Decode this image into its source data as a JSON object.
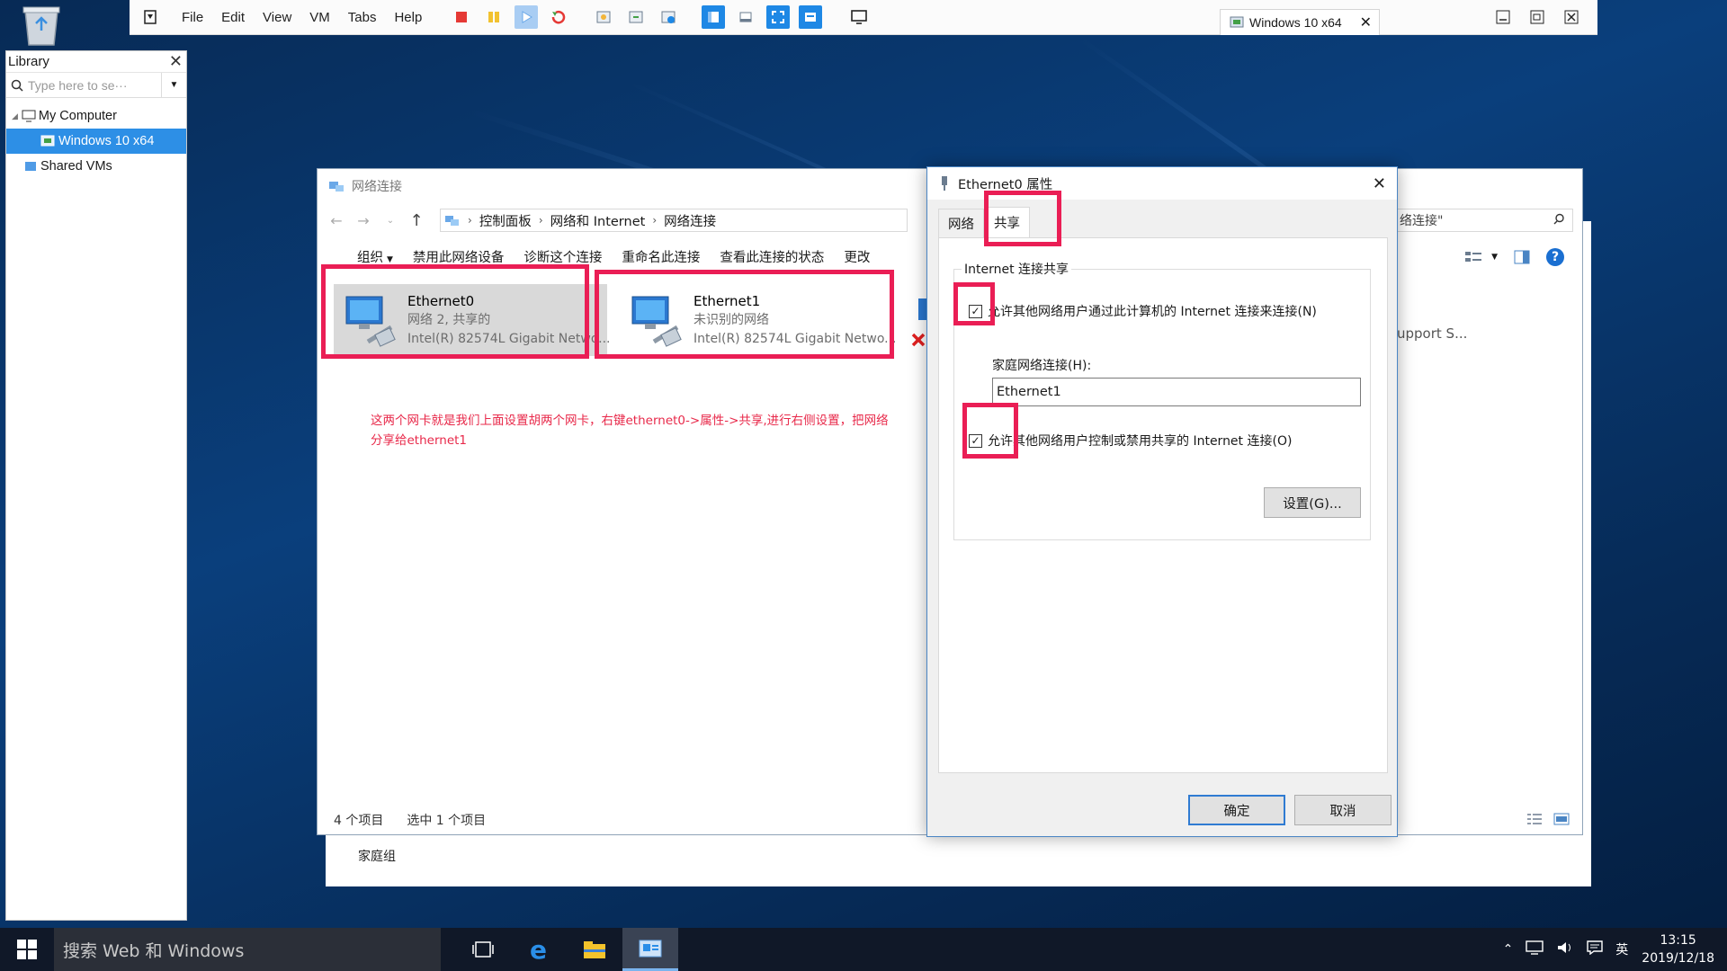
{
  "vm": {
    "menu": [
      "File",
      "Edit",
      "View",
      "VM",
      "Tabs",
      "Help"
    ],
    "tab_label": "Windows 10 x64"
  },
  "library": {
    "title": "Library",
    "search_placeholder": "Type here to se···",
    "tree": {
      "my_computer": "My Computer",
      "vm_item": "Windows 10 x64",
      "shared": "Shared VMs"
    }
  },
  "explorer": {
    "title": "网络连接",
    "breadcrumb": [
      "控制面板",
      "网络和 Internet",
      "网络连接"
    ],
    "search_text": "络连接\"",
    "commands": [
      "组织",
      "禁用此网络设备",
      "诊断这个连接",
      "重命名此连接",
      "查看此连接的状态",
      "更改"
    ],
    "connections": [
      {
        "name": "Ethernet0",
        "status": "网络  2, 共享的",
        "adapter": "Intel(R) 82574L Gigabit Netwo..."
      },
      {
        "name": "Ethernet1",
        "status": "未识别的网络",
        "adapter": "Intel(R) 82574L Gigabit Netwo..."
      }
    ],
    "annotation_line1": "这两个网卡就是我们上面设置胡两个网卡，右键ethernet0->属性->共享,进行右侧设置，把网络",
    "annotation_line2": "分享给ethernet1",
    "status_count": "4 个项目",
    "status_selected": "选中 1 个项目",
    "partial_text": "upport S...",
    "homegroup": "家庭组"
  },
  "dialog": {
    "title": "Ethernet0 属性",
    "tabs": [
      "网络",
      "共享"
    ],
    "group_label": "Internet 连接共享",
    "checkbox1": "允许其他网络用户通过此计算机的 Internet 连接来连接(N)",
    "home_label": "家庭网络连接(H):",
    "home_value": "Ethernet1",
    "checkbox2": "允许其他网络用户控制或禁用共享的 Internet 连接(O)",
    "settings_button": "设置(G)...",
    "ok": "确定",
    "cancel": "取消"
  },
  "taskbar": {
    "search": "搜索 Web 和 Windows",
    "ime": "英",
    "time": "13:15",
    "date": "2019/12/18"
  },
  "colors": {
    "highlight": "#ea1e55",
    "accent": "#1e88e5",
    "annotation": "#e8294a"
  }
}
